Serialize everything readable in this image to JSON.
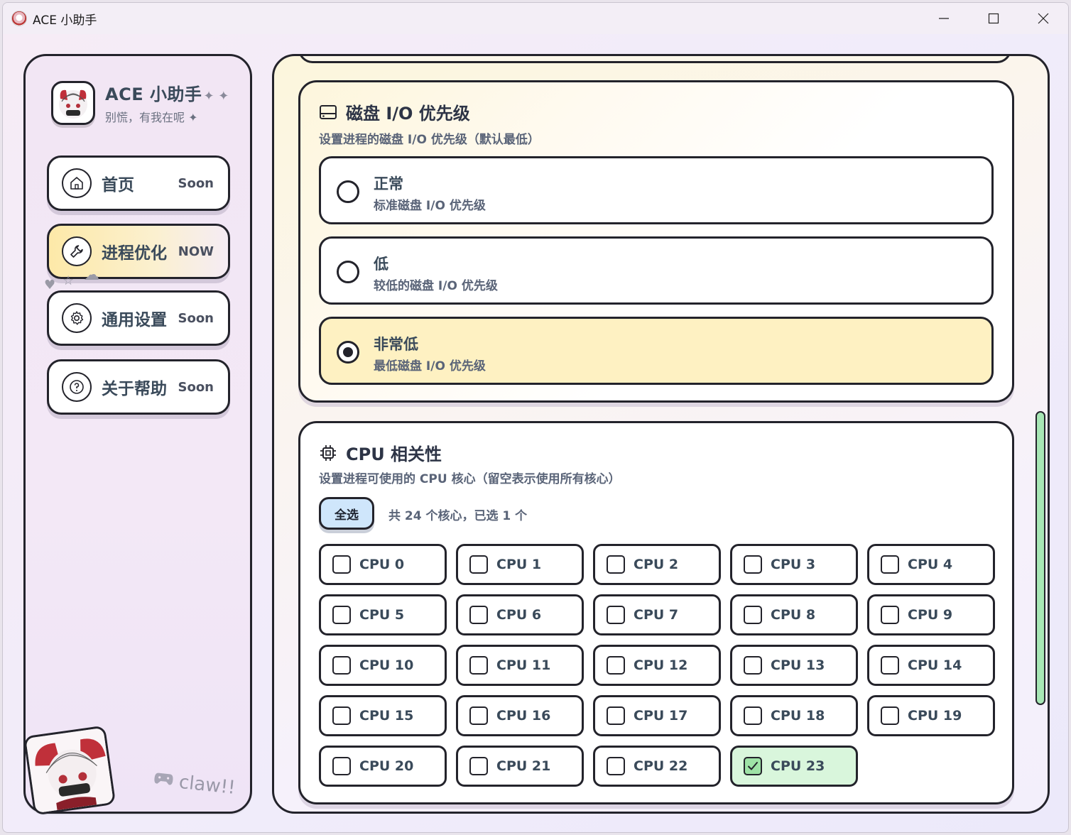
{
  "window": {
    "title": "ACE 小助手"
  },
  "sidebar": {
    "brand_title": "ACE 小助手",
    "brand_sparkle": "✦ ✦",
    "brand_subtitle": "别慌，有我在呢 ✦",
    "items": [
      {
        "label": "首页",
        "tag": "Soon",
        "icon": "home-icon",
        "active": false
      },
      {
        "label": "进程优化",
        "tag": "NOW",
        "icon": "wrench-icon",
        "active": true
      },
      {
        "label": "通用设置",
        "tag": "Soon",
        "icon": "gear-icon",
        "active": false
      },
      {
        "label": "关于帮助",
        "tag": "Soon",
        "icon": "help-icon",
        "active": false
      }
    ],
    "footer_text": "claw!!"
  },
  "disk_io": {
    "title": "磁盘 I/O 优先级",
    "description": "设置进程的磁盘 I/O 优先级（默认最低）",
    "options": [
      {
        "label": "正常",
        "sub": "标准磁盘 I/O 优先级",
        "selected": false
      },
      {
        "label": "低",
        "sub": "较低的磁盘 I/O 优先级",
        "selected": false
      },
      {
        "label": "非常低",
        "sub": "最低磁盘 I/O 优先级",
        "selected": true
      }
    ]
  },
  "cpu_affinity": {
    "title": "CPU 相关性",
    "description": "设置进程可使用的 CPU 核心（留空表示使用所有核心）",
    "select_all_label": "全选",
    "core_count_text": "共 24 个核心，已选 1 个",
    "cores": [
      {
        "label": "CPU 0",
        "checked": false
      },
      {
        "label": "CPU 1",
        "checked": false
      },
      {
        "label": "CPU 2",
        "checked": false
      },
      {
        "label": "CPU 3",
        "checked": false
      },
      {
        "label": "CPU 4",
        "checked": false
      },
      {
        "label": "CPU 5",
        "checked": false
      },
      {
        "label": "CPU 6",
        "checked": false
      },
      {
        "label": "CPU 7",
        "checked": false
      },
      {
        "label": "CPU 8",
        "checked": false
      },
      {
        "label": "CPU 9",
        "checked": false
      },
      {
        "label": "CPU 10",
        "checked": false
      },
      {
        "label": "CPU 11",
        "checked": false
      },
      {
        "label": "CPU 12",
        "checked": false
      },
      {
        "label": "CPU 13",
        "checked": false
      },
      {
        "label": "CPU 14",
        "checked": false
      },
      {
        "label": "CPU 15",
        "checked": false
      },
      {
        "label": "CPU 16",
        "checked": false
      },
      {
        "label": "CPU 17",
        "checked": false
      },
      {
        "label": "CPU 18",
        "checked": false
      },
      {
        "label": "CPU 19",
        "checked": false
      },
      {
        "label": "CPU 20",
        "checked": false
      },
      {
        "label": "CPU 21",
        "checked": false
      },
      {
        "label": "CPU 22",
        "checked": false
      },
      {
        "label": "CPU 23",
        "checked": true
      }
    ]
  },
  "colors": {
    "active_nav": "#fde9a8",
    "selected_option": "#fef1c2",
    "checked_core": "#d9f6dc",
    "select_all": "#cfe6fb",
    "scrollbar": "#a7e7b5",
    "outline": "#23232b"
  }
}
